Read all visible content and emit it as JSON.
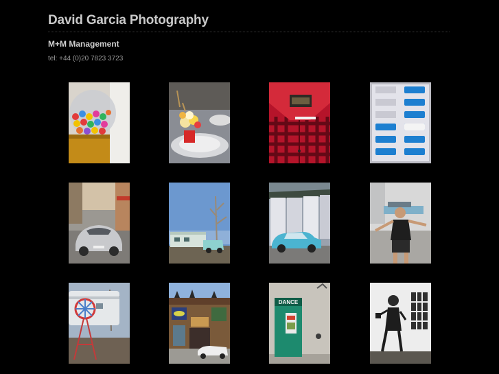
{
  "header": {
    "title": "David Garcia Photography",
    "agency": "M+M Management",
    "tel": "tel: +44 (0)20 7823 3723"
  },
  "gallery": {
    "items": [
      {
        "name": "gumball-machine",
        "icon": "gumball-photo"
      },
      {
        "name": "table-setting",
        "icon": "flowers-plate-photo"
      },
      {
        "name": "plaid-shirt",
        "icon": "shirt-photo"
      },
      {
        "name": "toy-cars-box",
        "icon": "toy-cars-photo"
      },
      {
        "name": "silver-porsche",
        "icon": "car-street-photo"
      },
      {
        "name": "trailer-truck",
        "icon": "desert-trailer-photo"
      },
      {
        "name": "blue-car-building",
        "icon": "blue-car-photo"
      },
      {
        "name": "boy-dancing",
        "icon": "boy-photo"
      },
      {
        "name": "windmill-trailer",
        "icon": "windmill-photo"
      },
      {
        "name": "painted-facade",
        "icon": "facade-photo"
      },
      {
        "name": "dance-door",
        "icon": "door-photo"
      },
      {
        "name": "graffiti-wall",
        "icon": "graffiti-photo"
      }
    ],
    "door_sign": "DANCE"
  }
}
